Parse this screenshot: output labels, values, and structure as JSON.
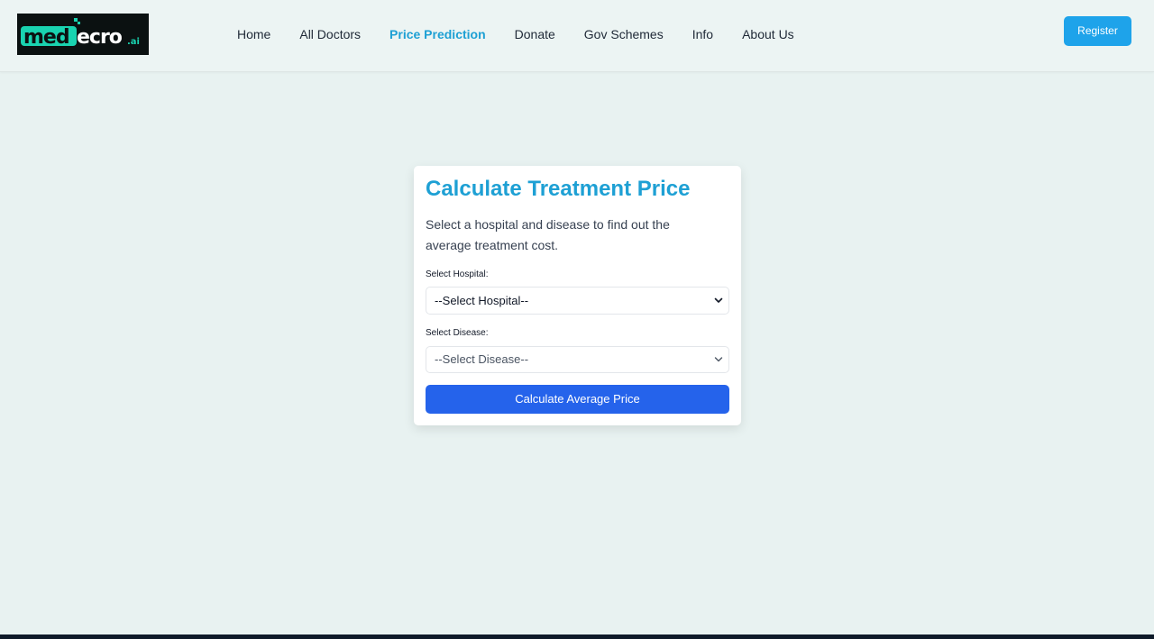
{
  "brand": {
    "logo_text": "medecro.ai",
    "colors": {
      "logo_bg": "#0b1111",
      "logo_accent": "#19d3b0"
    }
  },
  "nav": {
    "items": [
      {
        "label": "Home",
        "active": false
      },
      {
        "label": "All Doctors",
        "active": false
      },
      {
        "label": "Price Prediction",
        "active": true
      },
      {
        "label": "Donate",
        "active": false
      },
      {
        "label": "Gov Schemes",
        "active": false
      },
      {
        "label": "Info",
        "active": false
      },
      {
        "label": "About Us",
        "active": false
      }
    ],
    "register_label": "Register"
  },
  "calculator": {
    "title": "Calculate Treatment Price",
    "description": "Select a hospital and disease to find out the average treatment cost.",
    "hospital": {
      "label": "Select Hospital:",
      "selected": "--Select Hospital--"
    },
    "disease": {
      "label": "Select Disease:",
      "selected": "--Select Disease--"
    },
    "submit_label": "Calculate Average Price"
  },
  "colors": {
    "accent": "#1ea0d4",
    "primary_button": "#2563eb",
    "register_button": "#1ea3ea",
    "page_bg": "#e8f2f1"
  },
  "icons": {
    "select_arrow": "chevron-down-icon"
  }
}
